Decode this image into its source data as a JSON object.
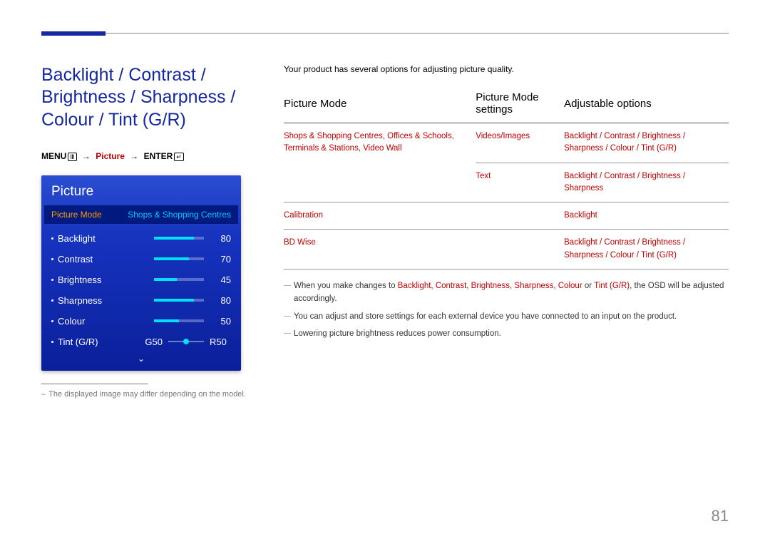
{
  "page_number": "81",
  "heading": "Backlight / Contrast / Brightness / Sharpness / Colour / Tint (G/R)",
  "nav": {
    "menu": "MENU",
    "picture": "Picture",
    "enter": "ENTER",
    "arrow": "→"
  },
  "osd": {
    "title": "Picture",
    "mode_label": "Picture Mode",
    "mode_value": "Shops & Shopping Centres",
    "items": [
      {
        "name": "Backlight",
        "value": "80",
        "pct": 80
      },
      {
        "name": "Contrast",
        "value": "70",
        "pct": 70
      },
      {
        "name": "Brightness",
        "value": "45",
        "pct": 45
      },
      {
        "name": "Sharpness",
        "value": "80",
        "pct": 80
      },
      {
        "name": "Colour",
        "value": "50",
        "pct": 50
      }
    ],
    "tint": {
      "name": "Tint (G/R)",
      "g": "G50",
      "r": "R50"
    }
  },
  "footnote_left": "The displayed image may differ depending on the model.",
  "intro": "Your product has several options for adjusting picture quality.",
  "table": {
    "headers": [
      "Picture Mode",
      "Picture Mode settings",
      "Adjustable options"
    ],
    "rows": [
      {
        "mode": "Shops & Shopping Centres, Offices & Schools, Terminals & Stations, Video Wall",
        "settings": "Videos/Images",
        "options": "Backlight / Contrast / Brightness / Sharpness / Colour / Tint (G/R)"
      },
      {
        "mode": "",
        "settings": "Text",
        "options": "Backlight / Contrast / Brightness / Sharpness"
      },
      {
        "mode": "Calibration",
        "settings": "",
        "options": "Backlight"
      },
      {
        "mode": "BD Wise",
        "settings": "",
        "options": "Backlight / Contrast / Brightness / Sharpness / Colour / Tint (G/R)"
      }
    ]
  },
  "notes": {
    "n1_pre": "When you make changes to ",
    "n1_terms": [
      "Backlight",
      "Contrast",
      "Brightness",
      "Sharpness",
      "Colour",
      "Tint (G/R)"
    ],
    "n1_post": ", the OSD will be adjusted accordingly.",
    "n2": "You can adjust and store settings for each external device you have connected to an input on the product.",
    "n3": "Lowering picture brightness reduces power consumption."
  }
}
